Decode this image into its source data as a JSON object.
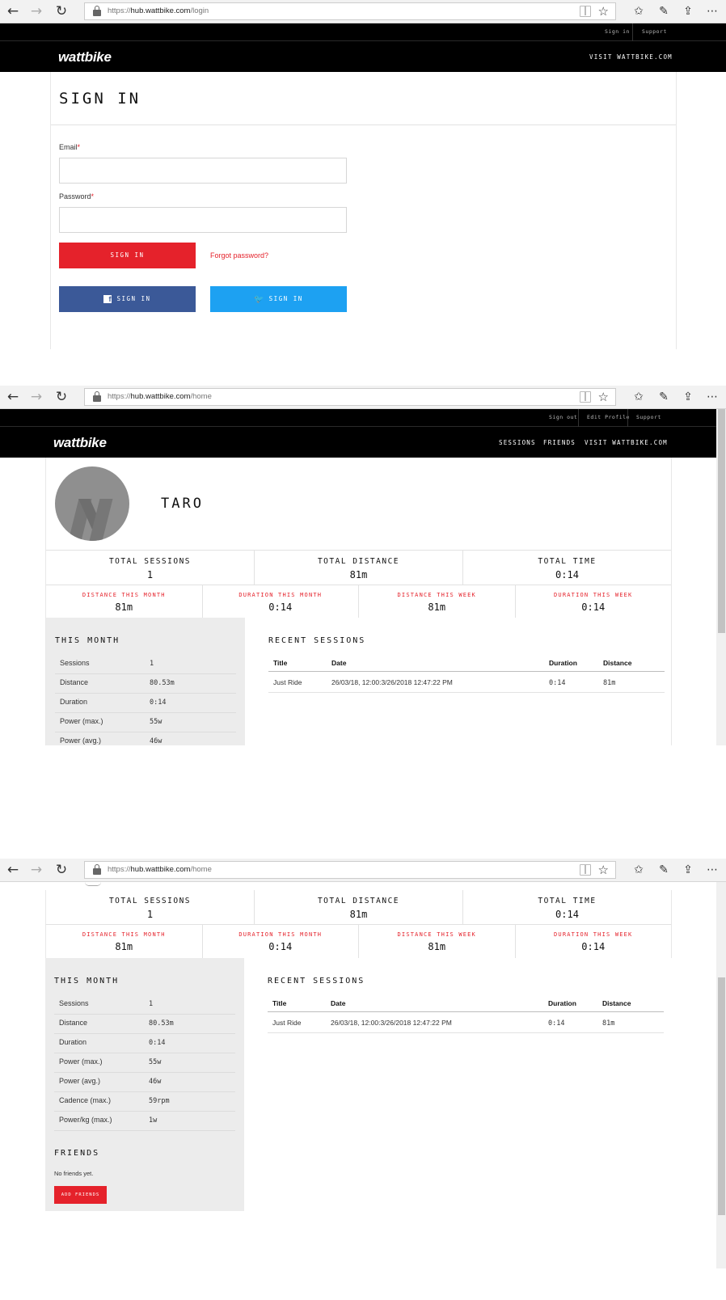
{
  "browser": {
    "back": "←",
    "forward": "→",
    "refresh": "↻",
    "star": "☆",
    "favorites": "✩",
    "pen": "✎",
    "share": "⇪",
    "more": "⋯",
    "url_login_prefix": "https://",
    "url_login_host": "hub.wattbike.com",
    "url_login_path": "/login",
    "url_home_prefix": "https://",
    "url_home_host": "hub.wattbike.com",
    "url_home_path": "/home"
  },
  "login": {
    "util_sign_in": "Sign in",
    "util_support": "Support",
    "logo": "wattbike",
    "nav_visit": "VISIT WATTBIKE.COM",
    "title": "SIGN IN",
    "email_label": "Email",
    "password_label": "Password",
    "required_mark": "*",
    "email_value": "",
    "password_value": "",
    "signin_button": "SIGN IN",
    "forgot_link": "Forgot password?",
    "facebook_button": "SIGN IN",
    "facebook_glyph": "f",
    "twitter_button": "SIGN IN",
    "twitter_glyph": "🐦"
  },
  "home": {
    "util_sign_out": "Sign out",
    "util_edit_profile": "Edit Profile",
    "util_support": "Support",
    "logo": "wattbike",
    "nav_sessions": "SESSIONS",
    "nav_friends": "FRIENDS",
    "nav_visit": "VISIT WATTBIKE.COM",
    "profile_name": "TARO",
    "totals": [
      {
        "label": "TOTAL SESSIONS",
        "value": "1"
      },
      {
        "label": "TOTAL DISTANCE",
        "value": "81m"
      },
      {
        "label": "TOTAL TIME",
        "value": "0:14"
      }
    ],
    "periods": [
      {
        "label": "DISTANCE THIS MONTH",
        "value": "81m"
      },
      {
        "label": "DURATION THIS MONTH",
        "value": "0:14"
      },
      {
        "label": "DISTANCE THIS WEEK",
        "value": "81m"
      },
      {
        "label": "DURATION THIS WEEK",
        "value": "0:14"
      }
    ],
    "this_month_title": "THIS MONTH",
    "this_month": [
      {
        "key": "Sessions",
        "value": "1"
      },
      {
        "key": "Distance",
        "value": "80.53m"
      },
      {
        "key": "Duration",
        "value": "0:14"
      },
      {
        "key": "Power (max.)",
        "value": "55w"
      },
      {
        "key": "Power (avg.)",
        "value": "46w"
      },
      {
        "key": "Cadence (max.)",
        "value": "59rpm"
      },
      {
        "key": "Power/kg (max.)",
        "value": "1w"
      }
    ],
    "recent_title": "RECENT SESSIONS",
    "recent_headers": {
      "title": "Title",
      "date": "Date",
      "duration": "Duration",
      "distance": "Distance"
    },
    "recent_rows": [
      {
        "title": "Just Ride",
        "date": "26/03/18, 12:00:3/26/2018 12:47:22 PM",
        "duration": "0:14",
        "distance": "81m"
      }
    ],
    "friends_title": "FRIENDS",
    "friends_empty": "No friends yet.",
    "add_friends_button": "ADD FRIENDS"
  }
}
